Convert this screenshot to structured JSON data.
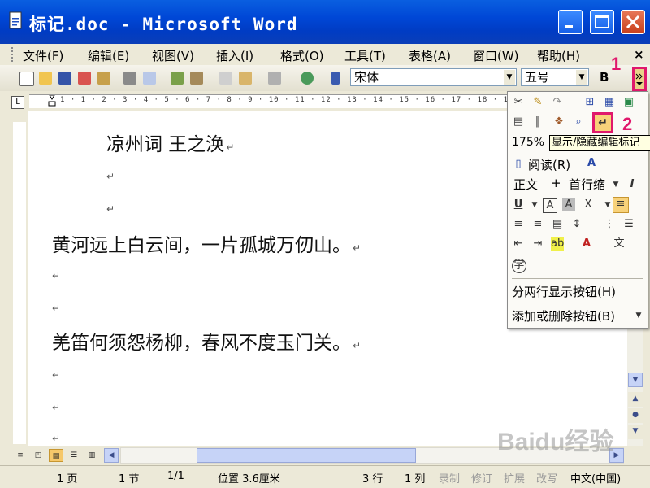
{
  "window": {
    "title": "标记.doc - Microsoft Word"
  },
  "menu": {
    "items": [
      "文件(F)",
      "编辑(E)",
      "视图(V)",
      "插入(I)",
      "格式(O)",
      "工具(T)",
      "表格(A)",
      "窗口(W)",
      "帮助(H)"
    ],
    "close": "×"
  },
  "toolbar": {
    "font_value": "宋体",
    "size_value": "五号",
    "bold_label": "B"
  },
  "ruler": {
    "ticks": "1 · 1 · 2 · 3 · 4 · 5 · 6 · 7 · 8 · 9 · 10 · 11 · 12 · 13 · 14 · 15 · 16 · 17 · 18 · 19 · 20 ·"
  },
  "document": {
    "lines": [
      "凉州词 王之涣",
      "黄河远上白云间，一片孤城万仞山。",
      "羌笛何须怨杨柳，春风不度玉门关。"
    ],
    "paragraph_mark": "↵"
  },
  "popup": {
    "zoom": "175%",
    "tooltip": "显示/隐藏编辑标记",
    "read_label": "阅读(R)",
    "style_label": "正文",
    "plus": "+",
    "indent_label": "首行缩",
    "two_rows_label": "分两行显示按钮(H)",
    "add_remove_label": "添加或删除按钮(B)"
  },
  "markers": {
    "one": "1",
    "two": "2"
  },
  "status": {
    "page": "1 页",
    "section": "1 节",
    "pages": "1/1",
    "position": "位置 3.6厘米",
    "line": "3 行",
    "col": "1 列",
    "rec": "录制",
    "trk": "修订",
    "ext": "扩展",
    "ovr": "改写",
    "lang": "中文(中国)"
  },
  "watermark": "Baidu经验",
  "colors": {
    "title_bar": "#0a5fe0",
    "highlight": "#e0186c"
  }
}
